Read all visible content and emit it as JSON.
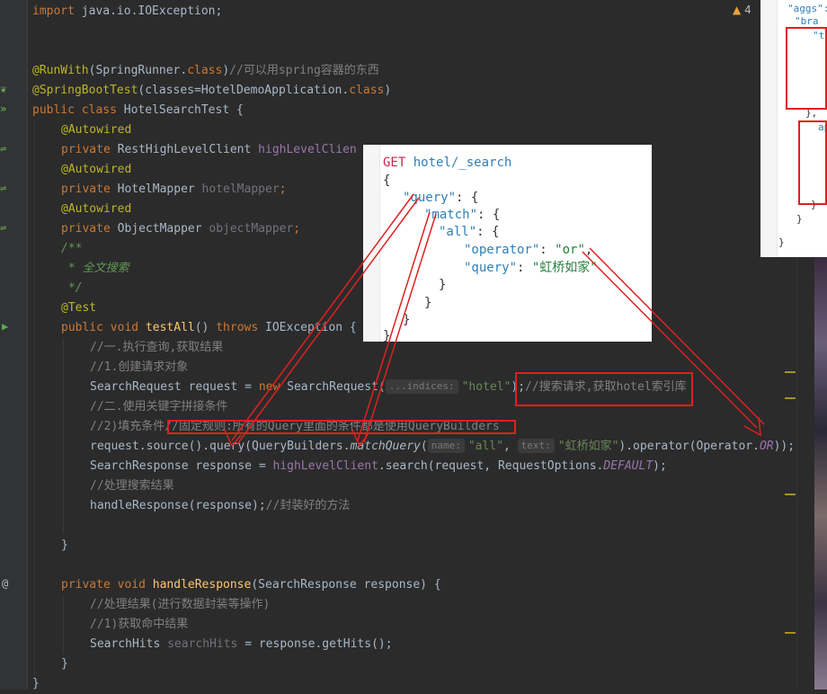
{
  "editor": {
    "l1": {
      "kw": "import",
      "rest": " java.io.IOException;"
    },
    "l4": {
      "ann": "@RunWith",
      "p1": "(SpringRunner.",
      "kw": "class",
      "p2": ")",
      "cmt": "//可以用spring容器的东西"
    },
    "l5": {
      "ann": "@SpringBootTest",
      "p1": "(classes=HotelDemoApplication.",
      "kw": "class",
      "p2": ")"
    },
    "l6": {
      "kw1": "public",
      "kw2": "class",
      "rest": " HotelSearchTest {"
    },
    "l7": {
      "ann": "@Autowired"
    },
    "l8": {
      "kw": "private",
      "type": " RestHighLevelClient ",
      "field": "highLevelClien"
    },
    "l9": {
      "ann": "@Autowired"
    },
    "l10": {
      "kw": "private",
      "type": " HotelMapper ",
      "field": "hotelMapper",
      "end": ";"
    },
    "l11": {
      "ann": "@Autowired"
    },
    "l12": {
      "kw": "private",
      "type": " ObjectMapper ",
      "field": "objectMapper",
      "end": ";"
    },
    "l13": {
      "doc": "/**"
    },
    "l14": {
      "doc": " * 全文搜索"
    },
    "l15": {
      "doc": " */"
    },
    "l16": {
      "ann": "@Test"
    },
    "l17": {
      "kw1": "public",
      "kw2": " void ",
      "method": "testAll",
      "mid": "() ",
      "kw3": "throws",
      "rest": " IOException {"
    },
    "l18": {
      "cmt": "//一.执行查询,获取结果"
    },
    "l19": {
      "cmt": "//1.创建请求对象"
    },
    "l20": {
      "p1": "SearchRequest request = ",
      "kw": "new",
      "p2": " SearchRequest(",
      "hint": "...indices:",
      "str": "\"hotel\"",
      "p3": ");",
      "cmt": "//搜索请求,获取hotel索引库"
    },
    "l21": {
      "cmt": "//二.使用关键字拼接条件"
    },
    "l22": {
      "cmt1": "//2)填充条件",
      "cmt2": "//固定规则:所有的Query里面的条件都是使用QueryBuilders"
    },
    "l23": {
      "p1": "request.source().query(QueryBuilders.",
      "it": "matchQuery",
      "p2": "(",
      "hint1": "name:",
      "str1": "\"all\"",
      "p3": ", ",
      "hint2": "text:",
      "str2": "\"虹桥如家\"",
      "p4": ").operator(Operator.",
      "sf": "OR",
      "p5": "));"
    },
    "l24": {
      "p1": "SearchResponse response = ",
      "field": "highLevelClient",
      "p2": ".search(request, RequestOptions.",
      "sf": "DEFAULT",
      "p3": ");"
    },
    "l25": {
      "cmt": "//处理搜索结果"
    },
    "l26": {
      "p1": "handleResponse(response);",
      "cmt": "//封装好的方法"
    },
    "l28": {
      "p": "}"
    },
    "l30": {
      "kw1": "private",
      "kw2": " void ",
      "method": "handleResponse",
      "rest": "(SearchResponse response) {"
    },
    "l31": {
      "cmt": "//处理结果(进行数据封装等操作)"
    },
    "l32": {
      "cmt": "//1)获取命中结果"
    },
    "l33": {
      "p1": "SearchHits ",
      "un": "searchHits",
      "p2": " = response.getHits();"
    },
    "l34": {
      "p": "}"
    },
    "l35": {
      "p": "}"
    }
  },
  "inspections": {
    "warning_count": "4"
  },
  "gutter_markers": {
    "at": "@"
  },
  "popup_query": {
    "line1": {
      "verb": "GET",
      "path": " hotel/_search"
    },
    "line2": "{",
    "line3": {
      "key": "\"query\"",
      "rest": ": {"
    },
    "line4": {
      "key": "\"match\"",
      "rest": ": {"
    },
    "line5": {
      "key": "\"all\"",
      "rest": ": {"
    },
    "line6": {
      "key": "\"operator\"",
      "mid": ": ",
      "val": "\"or\"",
      "end": ","
    },
    "line7": {
      "key": "\"query\"",
      "mid": ": ",
      "val": "\"虹桥如家\""
    },
    "line8": "}",
    "line9": "}",
    "line10": "}",
    "line11": "}"
  },
  "popup_aggs": {
    "t1": "\"aggs\":",
    "t2": "\"bra",
    "t3": "\"te",
    "t4": "},",
    "t5": "ap",
    "t6": "}",
    "t7": "}",
    "t8": "}"
  },
  "colors": {
    "annotation_red": "#e02020",
    "editor_bg": "#2b2b2b"
  }
}
